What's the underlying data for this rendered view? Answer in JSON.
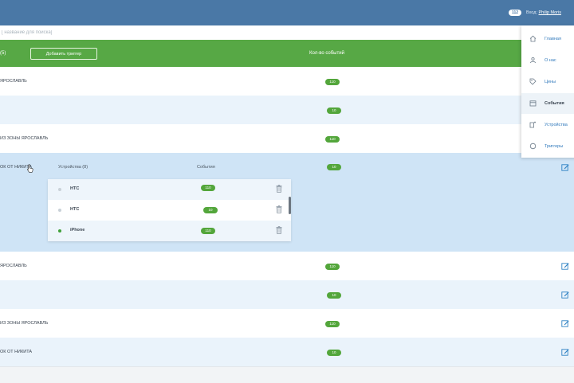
{
  "header": {
    "badge": "112",
    "user_prefix": "Вход:",
    "user_name": "Philip Moris"
  },
  "search": {
    "placeholder": "[ название для поиска]"
  },
  "table": {
    "col1": "(5)",
    "add_button": "Добавить триггер",
    "col2": "Кол-во событий",
    "rows": [
      {
        "name": "ЯРОСЛАВЛЬ",
        "count": "110"
      },
      {
        "name": "",
        "count": "10"
      },
      {
        "name": "ИЗ ЗОНЫ ЯРОСЛАВЛЬ",
        "count": "110"
      },
      {
        "name": "ОК ОТ НИКИТА",
        "count": "10",
        "expanded": true
      },
      {
        "name": "ЯРОСЛАВЛЬ",
        "count": "110"
      },
      {
        "name": "",
        "count": "10"
      },
      {
        "name": "ИЗ ЗОНЫ ЯРОСЛАВЛЬ",
        "count": "110"
      },
      {
        "name": "ОК ОТ НИКИТА",
        "count": "10"
      }
    ]
  },
  "subtable": {
    "col_devices": "Устройства (8)",
    "col_events": "События",
    "rows": [
      {
        "device": "HTC",
        "count": "110",
        "status_color": "#c9d1d8"
      },
      {
        "device": "HTC",
        "count": "10",
        "status_color": "#c9d1d8"
      },
      {
        "device": "iPhone",
        "count": "110",
        "status_color": "#3fa03a"
      }
    ]
  },
  "menu": {
    "items": [
      {
        "label": "Главная",
        "icon": "home-icon"
      },
      {
        "label": "О нас",
        "icon": "people-icon"
      },
      {
        "label": "Цены",
        "icon": "tag-icon"
      },
      {
        "label": "События",
        "icon": "calendar-icon",
        "active": true
      },
      {
        "label": "Устройства",
        "icon": "devices-icon"
      },
      {
        "label": "Триггеры",
        "icon": "trigger-icon"
      }
    ]
  },
  "colors": {
    "topbar": "#4a78a6",
    "accent_green": "#57a845",
    "pill": "#53a63b",
    "link_blue": "#2f78bb"
  }
}
